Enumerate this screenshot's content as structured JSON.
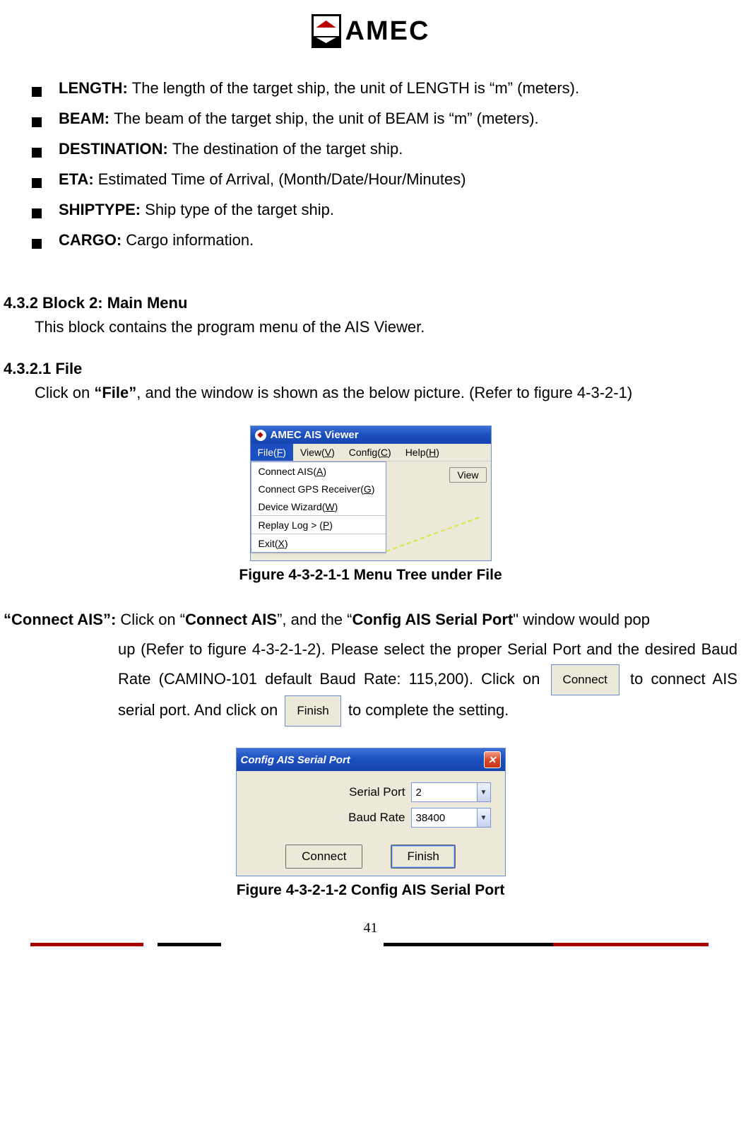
{
  "logo_text": "AMEC",
  "bullets": [
    {
      "label": "LENGTH:",
      "text": "The length of the target ship, the unit of LENGTH is “m” (meters)."
    },
    {
      "label": "BEAM:",
      "text": "The beam of the target ship, the unit of BEAM is “m” (meters)."
    },
    {
      "label": "DESTINATION:",
      "text": "The destination of the target ship."
    },
    {
      "label": "ETA:",
      "text": "Estimated Time of Arrival, (Month/Date/Hour/Minutes)"
    },
    {
      "label": "SHIPTYPE:",
      "text": "Ship type of the target ship."
    },
    {
      "label": "CARGO:",
      "text": "Cargo information."
    }
  ],
  "heading432": "4.3.2 Block 2: Main Menu",
  "body432": "This block contains the program menu of the AIS Viewer.",
  "heading4321": "4.3.2.1 File",
  "body4321_a": "Click on ",
  "body4321_bold": "“File”",
  "body4321_b": ", and the window is shown as the below picture. (Refer to figure 4-3-2-1)",
  "fig1": {
    "titlebar": "AMEC AIS Viewer",
    "menubar": {
      "file": {
        "text": "File(",
        "hk": "F",
        "after": ")"
      },
      "view": {
        "text": "View(",
        "hk": "V",
        "after": ")"
      },
      "config": {
        "text": "Config(",
        "hk": "C",
        "after": ")"
      },
      "help": {
        "text": "Help(",
        "hk": "H",
        "after": ")"
      }
    },
    "dropdown": {
      "connect_ais": {
        "text": "Connect AIS(",
        "hk": "A",
        "after": ")"
      },
      "connect_gps": {
        "text": "Connect GPS Receiver(",
        "hk": "G",
        "after": ")"
      },
      "device_wizard": {
        "text": "Device Wizard(",
        "hk": "W",
        "after": ")"
      },
      "replay_log": {
        "text": "Replay Log > (",
        "hk": "P",
        "after": ")"
      },
      "exit": {
        "text": "Exit(",
        "hk": "X",
        "after": ")"
      }
    },
    "view_button": "View",
    "caption": "Figure 4-3-2-1-1 Menu Tree under File"
  },
  "connect": {
    "lead": "“Connect AIS”: ",
    "t1": "Click on “",
    "bold1": "Connect AIS",
    "t2": "”, and the “",
    "bold2": "Config AIS Serial Port",
    "t3": "” window would pop up (Refer to figure 4-3-2-1-2). Please select the proper Serial Port and the desired Baud Rate (CAMINO-101 default Baud Rate: 115,200). Click on ",
    "btn_connect": "Connect",
    "t4": " to connect AIS serial port. And click on ",
    "btn_finish": "Finish",
    "t5": " to complete the setting."
  },
  "fig2": {
    "titlebar": "Config AIS Serial Port",
    "close": "✕",
    "serial_label": "Serial Port",
    "serial_value": "2",
    "baud_label": "Baud Rate",
    "baud_value": "38400",
    "connect_btn": "Connect",
    "finish_btn": "Finish",
    "caption": "Figure 4-3-2-1-2 Config AIS Serial Port"
  },
  "page_number": "41"
}
